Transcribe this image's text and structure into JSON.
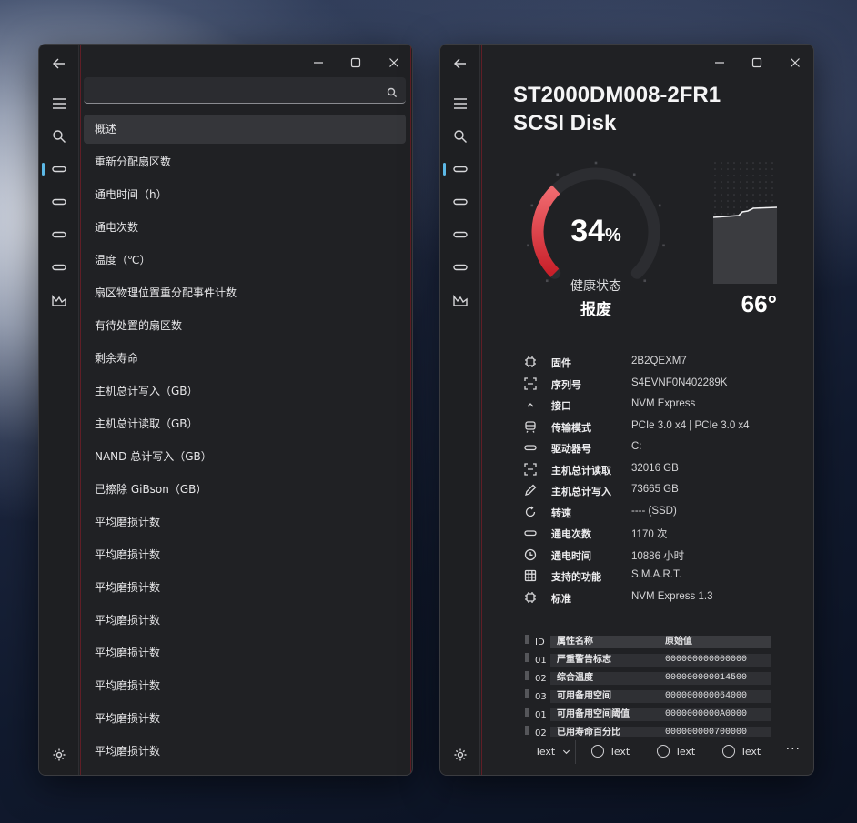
{
  "left": {
    "search": {
      "value": "",
      "placeholder": ""
    },
    "attributes": [
      {
        "label": "概述",
        "selected": true
      },
      {
        "label": "重新分配扇区数"
      },
      {
        "label": "通电时间（h）"
      },
      {
        "label": "通电次数"
      },
      {
        "label": "温度（℃）"
      },
      {
        "label": "扇区物理位置重分配事件计数"
      },
      {
        "label": "有待处置的扇区数"
      },
      {
        "label": "剩余寿命"
      },
      {
        "label": "主机总计写入（GB）"
      },
      {
        "label": "主机总计读取（GB）"
      },
      {
        "label": "NAND 总计写入（GB）"
      },
      {
        "label": "已擦除 GiBson（GB）"
      },
      {
        "label": "平均磨损计数"
      },
      {
        "label": "平均磨损计数"
      },
      {
        "label": "平均磨损计数"
      },
      {
        "label": "平均磨损计数"
      },
      {
        "label": "平均磨损计数"
      },
      {
        "label": "平均磨损计数"
      },
      {
        "label": "平均磨损计数"
      },
      {
        "label": "平均磨损计数"
      }
    ]
  },
  "right": {
    "title_line1": "ST2000DM008-2FR1",
    "title_line2": "SCSI Disk",
    "health": {
      "percent": 34,
      "percent_text": "34",
      "percent_sign": "%",
      "label": "健康状态",
      "status": "报废"
    },
    "temperature": {
      "value_text": "66°"
    },
    "info": [
      {
        "icon": "chip-icon",
        "key": "固件",
        "value": "2B2QEXM7"
      },
      {
        "icon": "scan-icon",
        "key": "序列号",
        "value": "S4EVNF0N402289K"
      },
      {
        "icon": "caret-up-icon",
        "key": "接口",
        "value": "NVM Express"
      },
      {
        "icon": "transfer-icon",
        "key": "传输模式",
        "value": "PCIe 3.0 x4 | PCIe 3.0 x4"
      },
      {
        "icon": "drive-icon",
        "key": "驱动器号",
        "value": "C:"
      },
      {
        "icon": "scan-icon",
        "key": "主机总计读取",
        "value": "32016 GB"
      },
      {
        "icon": "pencil-icon",
        "key": "主机总计写入",
        "value": "73665 GB"
      },
      {
        "icon": "rotate-icon",
        "key": "转速",
        "value": "---- (SSD)"
      },
      {
        "icon": "drive-icon",
        "key": "通电次数",
        "value": "1170 次"
      },
      {
        "icon": "clock-icon",
        "key": "通电时间",
        "value": "10886 小时"
      },
      {
        "icon": "grid-icon",
        "key": "支持的功能",
        "value": "S.M.A.R.T."
      },
      {
        "icon": "chip-icon",
        "key": "标准",
        "value": "NVM Express 1.3"
      }
    ],
    "smart": {
      "headers": {
        "id": "ID",
        "name": "属性名称",
        "raw": "原始值"
      },
      "rows": [
        {
          "id": "01",
          "name": "严重警告标志",
          "raw": "000000000000000"
        },
        {
          "id": "02",
          "name": "综合温度",
          "raw": "000000000014500"
        },
        {
          "id": "03",
          "name": "可用备用空间",
          "raw": "000000000064000"
        },
        {
          "id": "01",
          "name": "可用备用空间阈值",
          "raw": "0000000000A0000"
        },
        {
          "id": "02",
          "name": "已用寿命百分比",
          "raw": "000000000700000"
        }
      ]
    },
    "bottom": {
      "dropdown_label": "Text",
      "radio1": "Text",
      "radio2": "Text",
      "radio3": "Text",
      "more": "···"
    }
  },
  "colors": {
    "accent": "#5cb8e6",
    "danger": "#e0353d"
  }
}
